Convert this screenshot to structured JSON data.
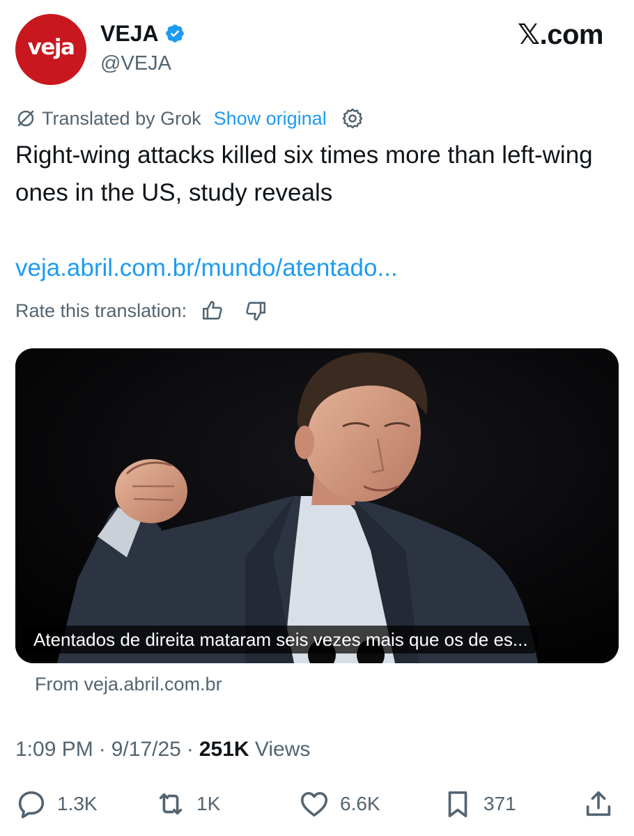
{
  "account": {
    "avatar_text": "veja",
    "name": "VEJA",
    "handle": "@VEJA",
    "verified_color": "#1d9bf0"
  },
  "site_logo": "𝕏.com",
  "translation": {
    "label": "Translated by Grok",
    "show_original": "Show original"
  },
  "post": {
    "text": "Right-wing attacks killed six times more than left-wing ones in the US, study reveals",
    "link": "veja.abril.com.br/mundo/atentado..."
  },
  "rate": {
    "label": "Rate this translation:"
  },
  "card": {
    "caption": "Atentados de direita mataram seis vezes mais que os de es...",
    "source": "From veja.abril.com.br"
  },
  "meta": {
    "time": "1:09 PM",
    "sep1": "·",
    "date": "9/17/25",
    "sep2": "·",
    "views_count": "251K",
    "views_label": "Views"
  },
  "actions": {
    "replies": "1.3K",
    "reposts": "1K",
    "likes": "6.6K",
    "bookmarks": "371"
  },
  "icons": {
    "translate": "translate-icon",
    "settings": "gear-icon",
    "thumbs_up": "thumbs-up-icon",
    "thumbs_down": "thumbs-down-icon",
    "reply": "reply-icon",
    "repost": "repost-icon",
    "like": "heart-icon",
    "bookmark": "bookmark-icon",
    "share": "share-icon"
  },
  "colors": {
    "brand_red": "#c8171e",
    "link_blue": "#1d9bf0",
    "muted": "#536471",
    "text": "#0f1419"
  }
}
